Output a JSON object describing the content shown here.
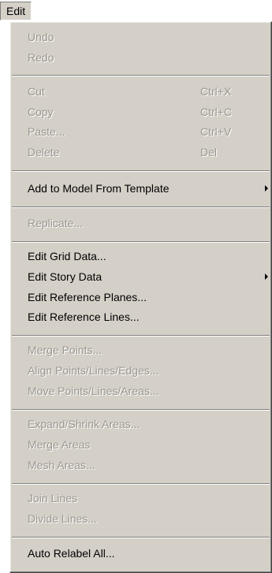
{
  "menubar": {
    "title": "Edit"
  },
  "menu": {
    "undo": "Undo",
    "redo": "Redo",
    "cut": "Cut",
    "cut_shortcut": "Ctrl+X",
    "copy": "Copy",
    "copy_shortcut": "Ctrl+C",
    "paste": "Paste...",
    "paste_shortcut": "Ctrl+V",
    "delete": "Delete",
    "delete_shortcut": "Del",
    "add_from_template": "Add to Model From Template",
    "replicate": "Replicate...",
    "edit_grid_data": "Edit Grid Data...",
    "edit_story_data": "Edit Story Data",
    "edit_reference_planes": "Edit Reference Planes...",
    "edit_reference_lines": "Edit Reference Lines...",
    "merge_points": "Merge Points...",
    "align_points": "Align Points/Lines/Edges...",
    "move_points": "Move Points/Lines/Areas...",
    "expand_shrink_areas": "Expand/Shrink Areas...",
    "merge_areas": "Merge Areas",
    "mesh_areas": "Mesh Areas...",
    "join_lines": "Join Lines",
    "divide_lines": "Divide Lines...",
    "auto_relabel_all": "Auto Relabel All..."
  },
  "icons": {
    "submenu_arrow": "submenu-arrow-icon"
  },
  "colors": {
    "menu_background": "#d4d0c8",
    "disabled_text": "#9a978f",
    "enabled_text": "#000000"
  }
}
